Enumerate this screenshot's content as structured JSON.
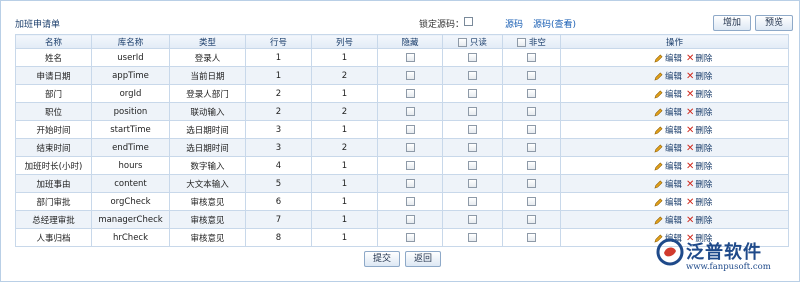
{
  "header": {
    "title": "加班申请单",
    "lock_label": "锁定源码：",
    "source_link": "源码",
    "source_view_link": "源码(查看)",
    "add_label": "增加",
    "preview_label": "预览"
  },
  "table": {
    "columns": [
      "名称",
      "库名称",
      "类型",
      "行号",
      "列号",
      "隐藏",
      "只读",
      "非空",
      "操作"
    ],
    "edit_label": "编辑",
    "delete_label": "删除",
    "rows": [
      {
        "name": "姓名",
        "db": "userId",
        "type": "登录人",
        "row": "1",
        "col": "1"
      },
      {
        "name": "申请日期",
        "db": "appTime",
        "type": "当前日期",
        "row": "1",
        "col": "2"
      },
      {
        "name": "部门",
        "db": "orgId",
        "type": "登录人部门",
        "row": "2",
        "col": "1"
      },
      {
        "name": "职位",
        "db": "position",
        "type": "联动输入",
        "row": "2",
        "col": "2"
      },
      {
        "name": "开始时间",
        "db": "startTime",
        "type": "选日期时间",
        "row": "3",
        "col": "1"
      },
      {
        "name": "结束时间",
        "db": "endTime",
        "type": "选日期时间",
        "row": "3",
        "col": "2"
      },
      {
        "name": "加班时长(小时)",
        "db": "hours",
        "type": "数字输入",
        "row": "4",
        "col": "1"
      },
      {
        "name": "加班事由",
        "db": "content",
        "type": "大文本输入",
        "row": "5",
        "col": "1"
      },
      {
        "name": "部门审批",
        "db": "orgCheck",
        "type": "审核意见",
        "row": "6",
        "col": "1"
      },
      {
        "name": "总经理审批",
        "db": "managerCheck",
        "type": "审核意见",
        "row": "7",
        "col": "1"
      },
      {
        "name": "人事归档",
        "db": "hrCheck",
        "type": "审核意见",
        "row": "8",
        "col": "1"
      }
    ]
  },
  "footer": {
    "submit_label": "提交",
    "back_label": "返回"
  },
  "logo": {
    "text": "泛普软件",
    "url": "www.fanpusoft.com"
  }
}
